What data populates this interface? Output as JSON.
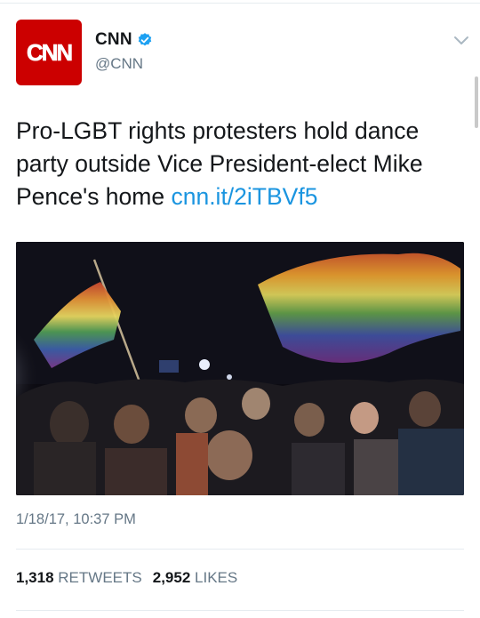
{
  "account": {
    "name": "CNN",
    "handle": "@CNN",
    "logo_text": "CNN",
    "verified": true
  },
  "tweet": {
    "text_before_link": "Pro-LGBT rights protesters hold dance party outside Vice President-elect Mike Pence's home ",
    "link_text": "cnn.it/2iTBVf5",
    "image_description_icon": "photo",
    "timestamp": "1/18/17, 10:37 PM"
  },
  "stats": {
    "retweets_count": "1,318",
    "retweets_label": "RETWEETS",
    "likes_count": "2,952",
    "likes_label": "LIKES"
  },
  "colors": {
    "brand_red": "#cc0000",
    "link_blue": "#1b95e0",
    "verified_blue": "#1da1f2",
    "secondary_text": "#657786"
  },
  "icons": [
    "verified-badge-icon",
    "chevron-down-icon"
  ]
}
